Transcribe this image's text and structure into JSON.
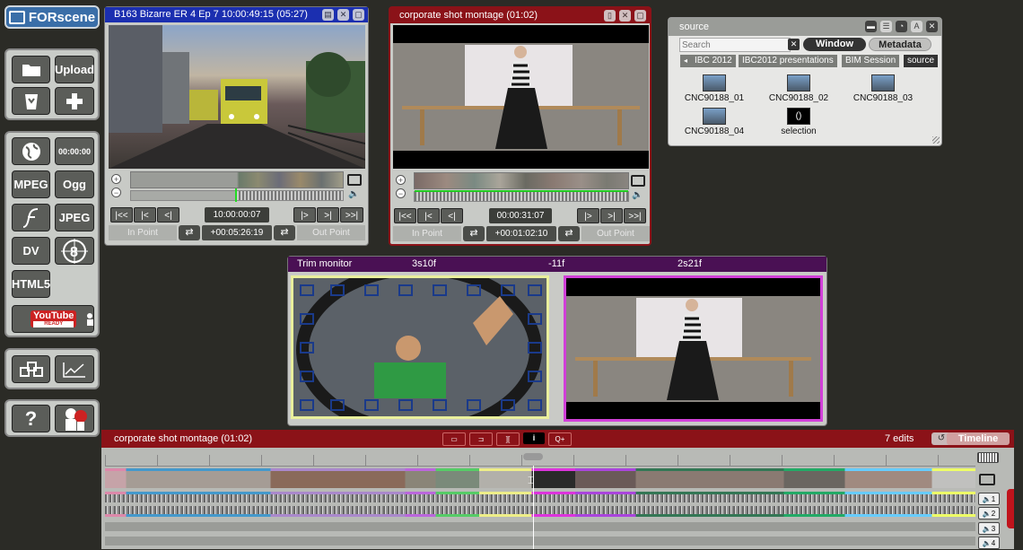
{
  "app": {
    "logo": "FORscene"
  },
  "toolbar": {
    "upload": "Upload",
    "timecode_btn": "00:00:00",
    "mpeg": "MPEG",
    "ogg": "Ogg",
    "jpeg": "JPEG",
    "dv": "DV",
    "html5": "HTML5",
    "youtube": "YouTube",
    "youtube_sub": "READY",
    "help": "?"
  },
  "viewer1": {
    "title": "B163 Bizarre ER 4 Ep 7 10:00:49:15 (05:27)",
    "timecode": "10:00:00:07",
    "in_point": "In Point",
    "duration": "+00:05:26:19",
    "out_point": "Out Point",
    "buttons": [
      "I<<",
      "I<",
      "<I",
      "I>",
      ">I",
      ">>I"
    ]
  },
  "viewer2": {
    "title": "corporate shot montage (01:02)",
    "timecode": "00:00:31:07",
    "in_point": "In Point",
    "duration": "+00:01:02:10",
    "out_point": "Out Point",
    "buttons": [
      "I<<",
      "I<",
      "<I",
      "I>",
      ">I",
      ">>I"
    ]
  },
  "trim": {
    "title": "Trim monitor",
    "left_offset": "3s10f",
    "mid_offset": "-11f",
    "right_offset": "2s21f"
  },
  "source": {
    "title": "source",
    "search_placeholder": "Search",
    "window_btn": "Window",
    "metadata_btn": "Metadata",
    "breadcrumbs": [
      "IBC 2012",
      "IBC2012 presentations",
      "BIM Session",
      "source"
    ],
    "clips": [
      "CNC90188_01",
      "CNC90188_02",
      "CNC90188_03",
      "CNC90188_04",
      "selection"
    ]
  },
  "timeline": {
    "title": "corporate shot montage (01:02)",
    "edits": "7 edits",
    "timeline_btn": "Timeline",
    "tracks": [
      "1",
      "2",
      "3",
      "4"
    ]
  },
  "colors": {
    "viewer1_title": "#1b2fb0",
    "viewer2_title": "#8b1218",
    "trim_title": "#4a1054",
    "timeline_title": "#8b1218",
    "trim_right_border": "#d13fd8",
    "trim_left_border": "#e9ef9c"
  }
}
